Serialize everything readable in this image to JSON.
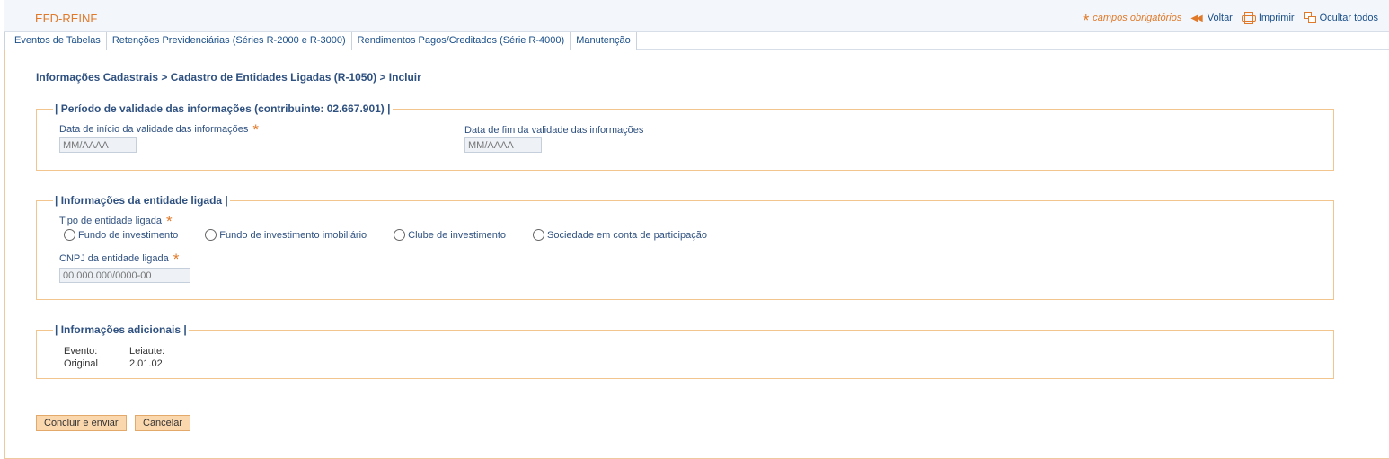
{
  "header": {
    "app_title": "EFD-REINF",
    "required_legend": "campos obrigatórios",
    "actions": [
      {
        "label": "Voltar",
        "icon": "double-left-arrow-icon"
      },
      {
        "label": "Imprimir",
        "icon": "printer-icon"
      },
      {
        "label": "Ocultar todos",
        "icon": "collapse-windows-icon"
      }
    ]
  },
  "tabs": [
    {
      "label": "Eventos de Tabelas"
    },
    {
      "label": "Retenções Previdenciárias (Séries R-2000 e R-3000)"
    },
    {
      "label": "Rendimentos Pagos/Creditados (Série R-4000)"
    },
    {
      "label": "Manutenção"
    }
  ],
  "breadcrumb": "Informações Cadastrais > Cadastro de Entidades Ligadas (R-1050) > Incluir",
  "periodo": {
    "legend": "| Período de validade das informações (contribuinte: 02.667.901) |",
    "inicio_label": "Data de início da validade das informações",
    "inicio_placeholder": "MM/AAAA",
    "fim_label": "Data de fim da validade das informações",
    "fim_placeholder": "MM/AAAA"
  },
  "entidade": {
    "legend": "| Informações da entidade ligada |",
    "tipo_label": "Tipo de entidade ligada",
    "tipo_options": [
      {
        "label": "Fundo de investimento"
      },
      {
        "label": "Fundo de investimento imobiliário"
      },
      {
        "label": "Clube de investimento"
      },
      {
        "label": "Sociedade em conta de participação"
      }
    ],
    "cnpj_label": "CNPJ da entidade ligada",
    "cnpj_placeholder": "00.000.000/0000-00"
  },
  "adicionais": {
    "legend": "| Informações adicionais |",
    "evento_label": "Evento:",
    "evento_value": "Original",
    "leiaute_label": "Leiaute:",
    "leiaute_value": "2.01.02"
  },
  "buttons": {
    "submit": "Concluir e enviar",
    "cancel": "Cancelar"
  },
  "colors": {
    "accent": "#e07a2a",
    "link": "#1a4f8a",
    "heading": "#2f5180",
    "fieldset_border": "#f2c58f",
    "button_bg": "#fbd7ad"
  }
}
